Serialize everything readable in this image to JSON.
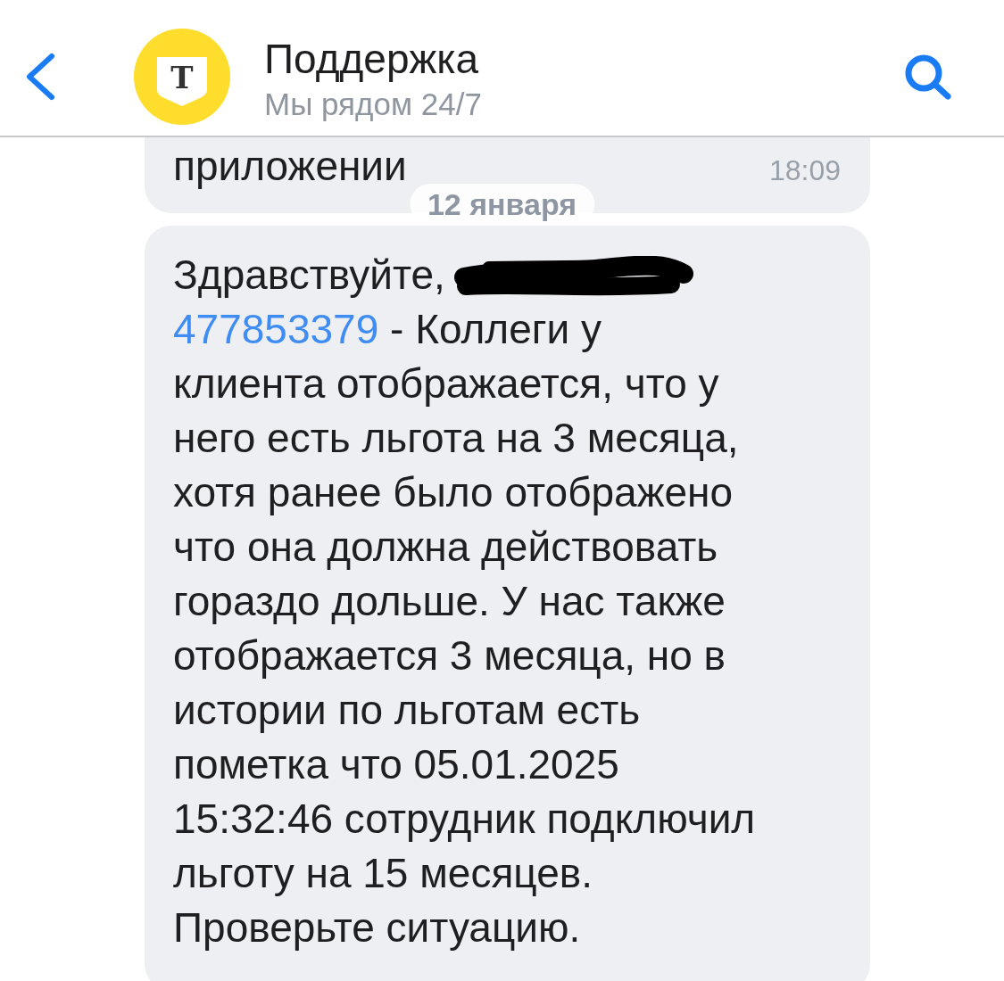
{
  "header": {
    "title": "Поддержка",
    "subtitle": "Мы рядом 24/7",
    "logo_letter": "Т"
  },
  "chat": [
    {
      "kind": "message",
      "text": "приложении",
      "time": "18:09"
    },
    {
      "kind": "date",
      "text": "12 января"
    },
    {
      "kind": "greeting_message",
      "greeting": "Здравствуйте,",
      "redacted": true,
      "link": "477853379",
      "body": " - Коллеги у\nклиента отображается, что у\nнего есть льгота на 3 месяца,\nхотя ранее было отображено\nчто она должна действовать\nгораздо дольше. У нас также\nотображается 3 месяца, но в\nистории по льготам есть\nпометка что 05.01.2025\n15:32:46 сотрудник подключил\nльготу на 15 месяцев.\nПроверьте ситуацию."
    }
  ]
}
